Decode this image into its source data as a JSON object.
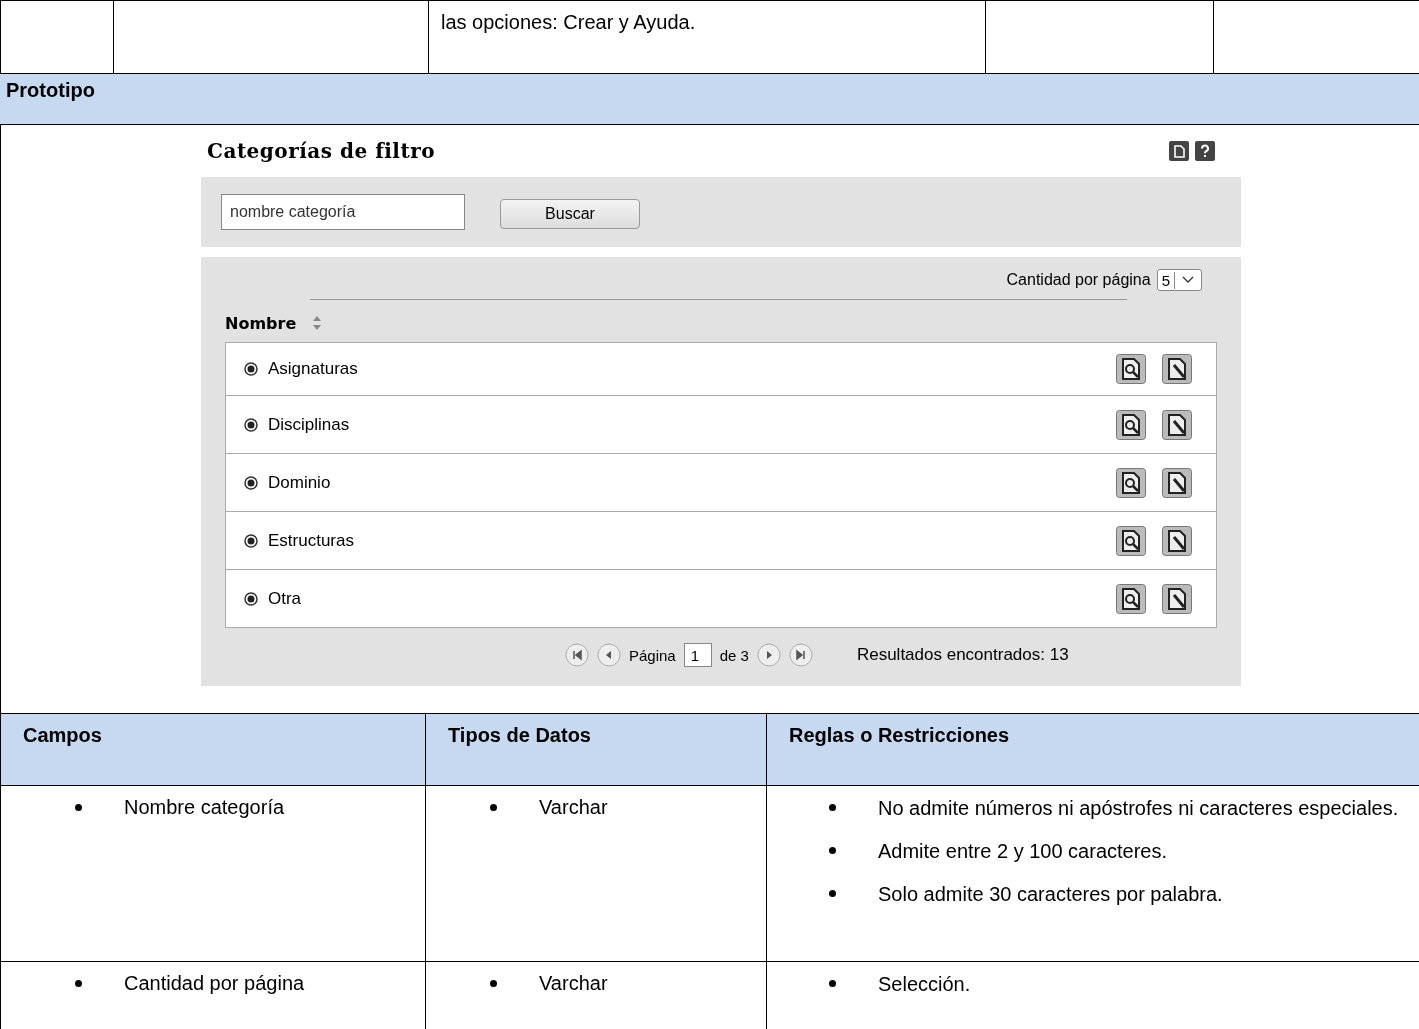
{
  "top_row": {
    "text": "las opciones: Crear y Ayuda."
  },
  "section_title": "Prototipo",
  "prototype": {
    "title": "Categorías de filtro",
    "search": {
      "placeholder": "nombre categoría"
    },
    "search_button": "Buscar",
    "page_size_label": "Cantidad por página",
    "page_size": "5",
    "column": "Nombre",
    "rows": [
      {
        "name": "Asignaturas",
        "selected": true
      },
      {
        "name": "Disciplinas",
        "selected": true
      },
      {
        "name": "Dominio",
        "selected": true
      },
      {
        "name": "Estructuras",
        "selected": true
      },
      {
        "name": "Otra",
        "selected": true
      }
    ],
    "pager": {
      "label": "Página",
      "page": "1",
      "of": "de 3",
      "results": "Resultados encontrados: 13"
    }
  },
  "fields_table": {
    "columns": [
      "Campos",
      "Tipos de Datos",
      "Reglas o Restricciones"
    ],
    "rows": [
      {
        "field": "Nombre categoría",
        "type": "Varchar",
        "rules": [
          "No admite números ni apóstrofes ni caracteres especiales.",
          "Admite entre 2 y 100 caracteres.",
          "Solo admite 30 caracteres por palabra."
        ]
      },
      {
        "field": "Cantidad por página",
        "type": "Varchar",
        "rules": [
          "Selección."
        ]
      }
    ]
  }
}
